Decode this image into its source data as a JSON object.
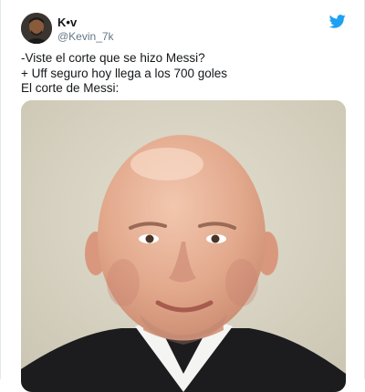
{
  "tweet": {
    "author": {
      "display_name": "K•v",
      "handle": "@Kevin_7k"
    },
    "lines": [
      "-Viste el corte que se hizo Messi?",
      "+ Uff seguro hoy llega a los 700 goles",
      "El corte de Messi:"
    ],
    "icon": "twitter-bird-icon",
    "colors": {
      "twitter_blue": "#1da1f2",
      "text": "#14171a",
      "handle": "#657786"
    }
  }
}
